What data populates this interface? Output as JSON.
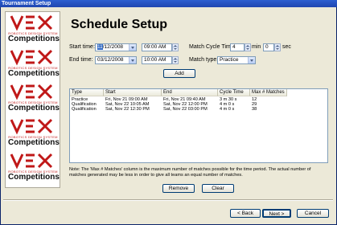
{
  "window": {
    "title": "Tournament Setup"
  },
  "sidebar": {
    "logos": [
      {
        "brand": "VEX",
        "tagline": "ROBOTICS DESIGN SYSTEM",
        "caption": "Competitions"
      },
      {
        "brand": "VEX",
        "tagline": "ROBOTICS DESIGN SYSTEM",
        "caption": "Competitions"
      },
      {
        "brand": "VEX",
        "tagline": "ROBOTICS DESIGN SYSTEM",
        "caption": "Competitions"
      },
      {
        "brand": "VEX",
        "tagline": "ROBOTICS DESIGN SYSTEM",
        "caption": "Competitions"
      },
      {
        "brand": "VEX",
        "tagline": "ROBOTICS DESIGN SYSTEM",
        "caption": "Competitions"
      }
    ]
  },
  "page": {
    "heading": "Schedule Setup"
  },
  "form": {
    "start_time_label": "Start time:",
    "start_date_sel": "11",
    "start_date_rest": "/12/2008",
    "start_time_value": "09:00 AM",
    "end_time_label": "End time:",
    "end_date_value": "03/12/2008",
    "end_time_value": "10:00 AM",
    "match_cycle_label": "Match Cycle Times:",
    "cycle_min_value": "4",
    "min_label": "min",
    "cycle_sec_value": "0",
    "sec_label": "sec",
    "match_type_label": "Match type:",
    "match_type_value": "Practice",
    "add_label": "Add"
  },
  "table": {
    "columns": [
      "Type",
      "Start",
      "End",
      "Cycle Time",
      "Max # Matches"
    ],
    "rows": [
      {
        "type": "Practice",
        "start": "Fri, Nov 21 09:00 AM",
        "end": "Fri, Nov 21 09:40 AM",
        "cycle": "3 m 30 s",
        "max": "12"
      },
      {
        "type": "Qualification",
        "start": "Sat, Nov 22 10:05 AM",
        "end": "Sat, Nov 22 12:00 PM",
        "cycle": "4 m 0 s",
        "max": "29"
      },
      {
        "type": "Qualification",
        "start": "Sat, Nov 22 12:30 PM",
        "end": "Sat, Nov 22 03:00 PM",
        "cycle": "4 m 0 s",
        "max": "38"
      }
    ]
  },
  "note": "Note: The 'Max # Matches' column is the maximum number of matches possible for the time period.  The actual number of matches generated may be less in order to give all teams an equal number of matches.",
  "actions": {
    "remove_label": "Remove",
    "clear_label": "Clear"
  },
  "nav": {
    "back_label": "< Back",
    "next_label": "Next >",
    "cancel_label": "Cancel"
  },
  "colors": {
    "titlebar": "#1f46b0",
    "vex_red": "#c01818",
    "selection": "#316ac5"
  }
}
